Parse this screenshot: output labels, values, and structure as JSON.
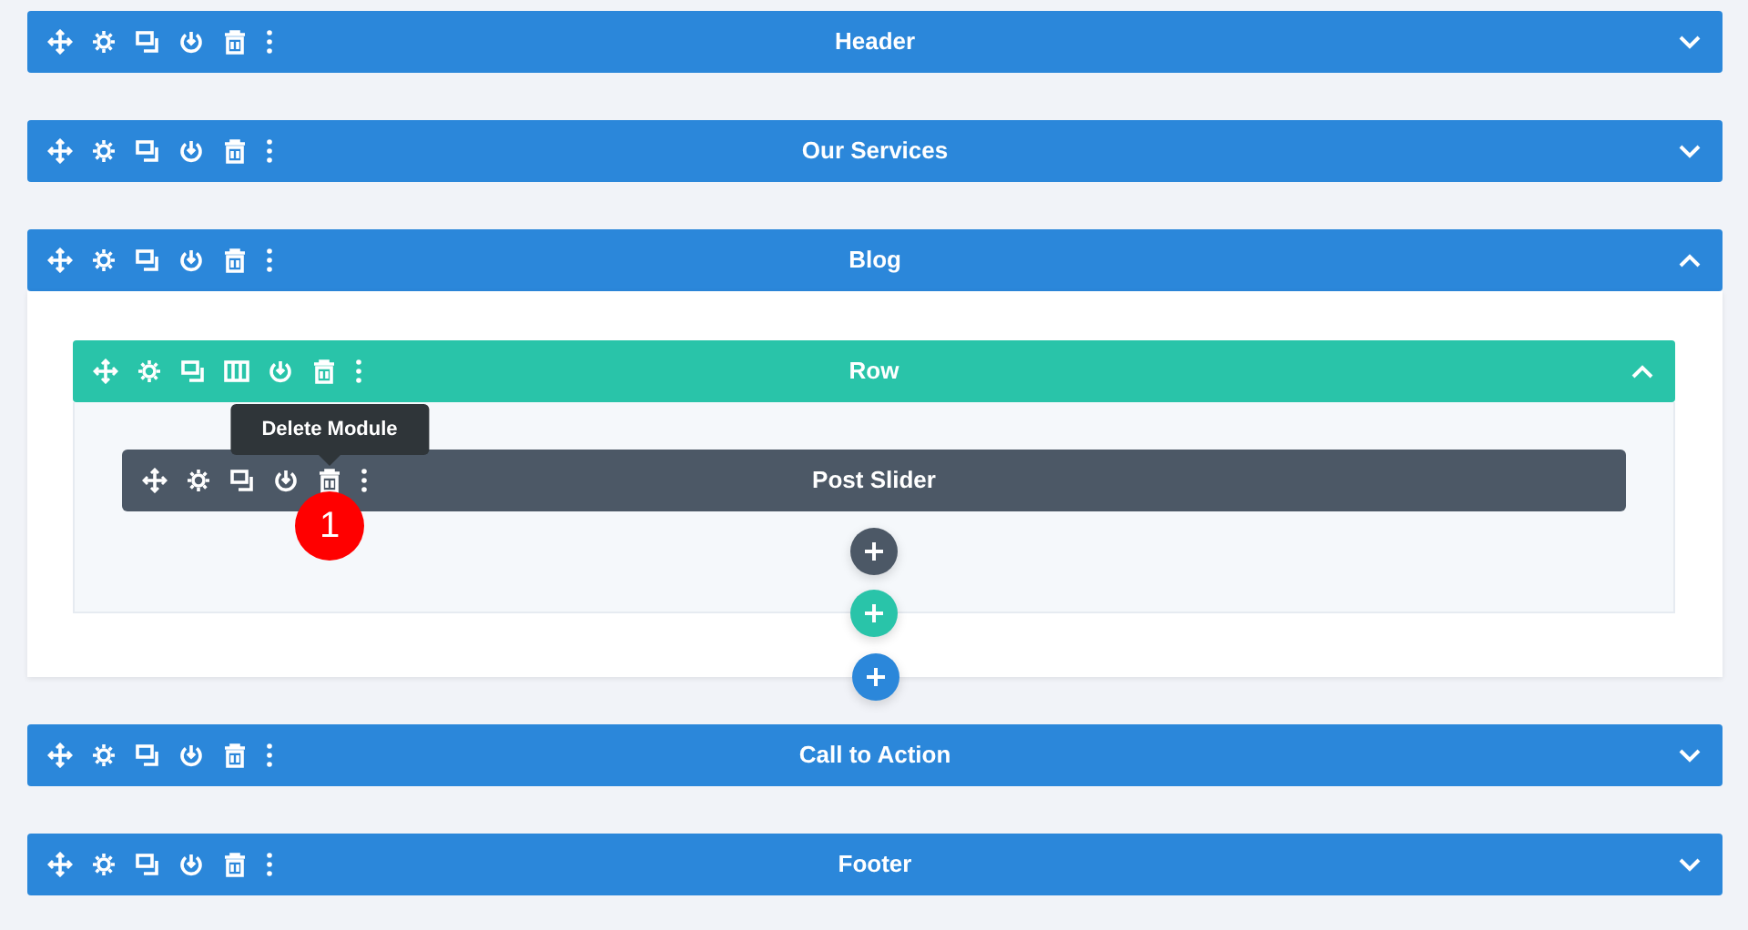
{
  "sections": [
    {
      "kind": "section",
      "title": "Header",
      "expanded": false
    },
    {
      "kind": "section",
      "title": "Our Services",
      "expanded": false
    },
    {
      "kind": "section",
      "title": "Blog",
      "expanded": true,
      "rows": [
        {
          "kind": "row",
          "title": "Row",
          "expanded": true,
          "modules": [
            {
              "kind": "module",
              "title": "Post Slider",
              "tooltip": "Delete Module",
              "badge": "1"
            }
          ]
        }
      ]
    },
    {
      "kind": "section",
      "title": "Call to Action",
      "expanded": false
    },
    {
      "kind": "section",
      "title": "Footer",
      "expanded": false
    }
  ]
}
